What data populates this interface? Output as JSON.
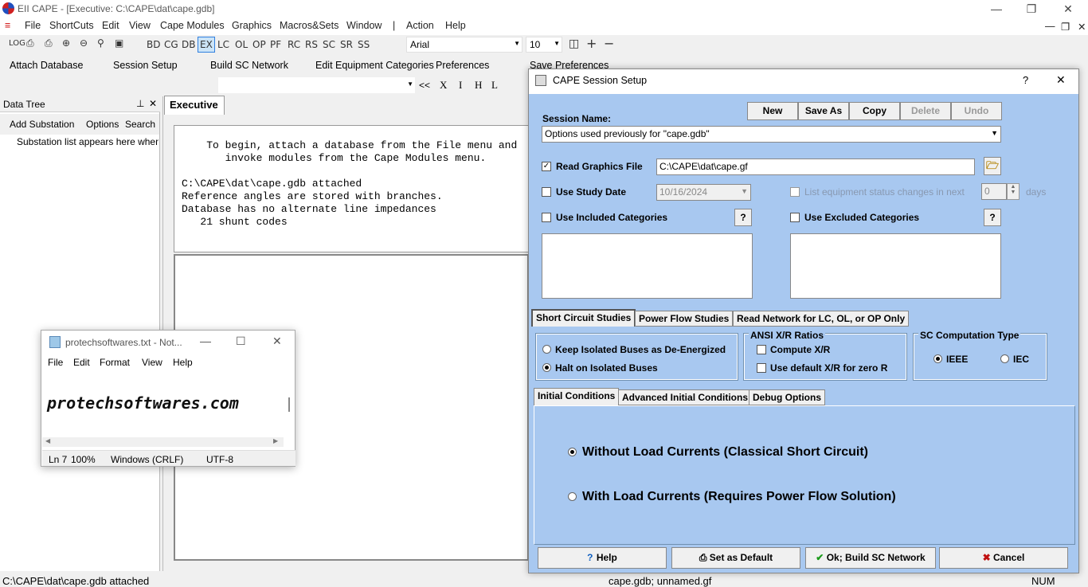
{
  "app": {
    "title": "EII CAPE - [Executive: C:\\CAPE\\dat\\cape.gdb]"
  },
  "menu": [
    "File",
    "ShortCuts",
    "Edit",
    "View",
    "Cape Modules",
    "Graphics",
    "Macros&Sets",
    "Window",
    "|",
    "Action",
    "Help"
  ],
  "toolbar": {
    "buttons": [
      "LOG",
      "BD",
      "CG",
      "DB",
      "EX",
      "LC",
      "OL",
      "OP",
      "PF",
      "RC",
      "RS",
      "SC",
      "SR",
      "SS"
    ],
    "font": "Arial",
    "size": "10",
    "nav": [
      "<<",
      "X",
      "I",
      "H",
      "L"
    ]
  },
  "quickbar": [
    "Attach Database",
    "Session Setup",
    "Build SC Network",
    "Edit Equipment Categories",
    "Preferences",
    "Save Preferences"
  ],
  "datatree": {
    "title": "Data Tree",
    "pin": "⊥",
    "close": "✕",
    "menu": [
      "Add Substation",
      "Options",
      "Search"
    ],
    "hint": "Substation list appears here when"
  },
  "executive": {
    "tab": "Executive",
    "lines": [
      "    To begin, attach a database from the File menu and",
      "       invoke modules from the Cape Modules menu.",
      "",
      "C:\\CAPE\\dat\\cape.gdb attached",
      "Reference angles are stored with branches.",
      "Database has no alternate line impedances",
      "   21 shunt codes"
    ]
  },
  "notepad": {
    "title": "protechsoftwares.txt - Not...",
    "menu": [
      "File",
      "Edit",
      "Format",
      "View",
      "Help"
    ],
    "content": "protechsoftwares.com",
    "status": [
      "Ln 7",
      "100%",
      "Windows (CRLF)",
      "UTF-8"
    ]
  },
  "status": {
    "left": "C:\\CAPE\\dat\\cape.gdb attached",
    "mid": "cape.gdb; unnamed.gf",
    "num": "NUM"
  },
  "dialog": {
    "title": "CAPE Session Setup",
    "help": "?",
    "close": "✕",
    "buttons": {
      "new": "New",
      "saveas": "Save As",
      "copy": "Copy",
      "delete": "Delete",
      "undo": "Undo"
    },
    "session_label": "Session Name:",
    "session_value": "Options used previously for \"cape.gdb\"",
    "read_graphics": "Read Graphics File",
    "graphics_path": "C:\\CAPE\\dat\\cape.gf",
    "use_study_date": "Use Study Date",
    "study_date": "10/16/2024",
    "list_changes": "List equipment status changes in next",
    "days_value": "0",
    "days": "days",
    "use_included": "Use Included Categories",
    "use_excluded": "Use Excluded Categories",
    "q": "?",
    "tabs": [
      "Short Circuit Studies",
      "Power Flow Studies",
      "Read Network for LC, OL, or OP Only"
    ],
    "keep_isolated": "Keep Isolated Buses as De-Energized",
    "halt_isolated": "Halt on Isolated Buses",
    "ansi_title": "ANSI X/R Ratios",
    "compute_xr": "Compute X/R",
    "default_xr": "Use default X/R for zero R",
    "sc_title": "SC Computation Type",
    "ieee": "IEEE",
    "iec": "IEC",
    "subtabs": [
      "Initial Conditions",
      "Advanced Initial Conditions",
      "Debug Options"
    ],
    "without_load": "Without Load Currents (Classical Short Circuit)",
    "with_load": "With Load Currents (Requires Power Flow Solution)",
    "footer": {
      "help": "Help",
      "default": "Set as Default",
      "ok": "Ok; Build SC Network",
      "cancel": "Cancel"
    }
  }
}
